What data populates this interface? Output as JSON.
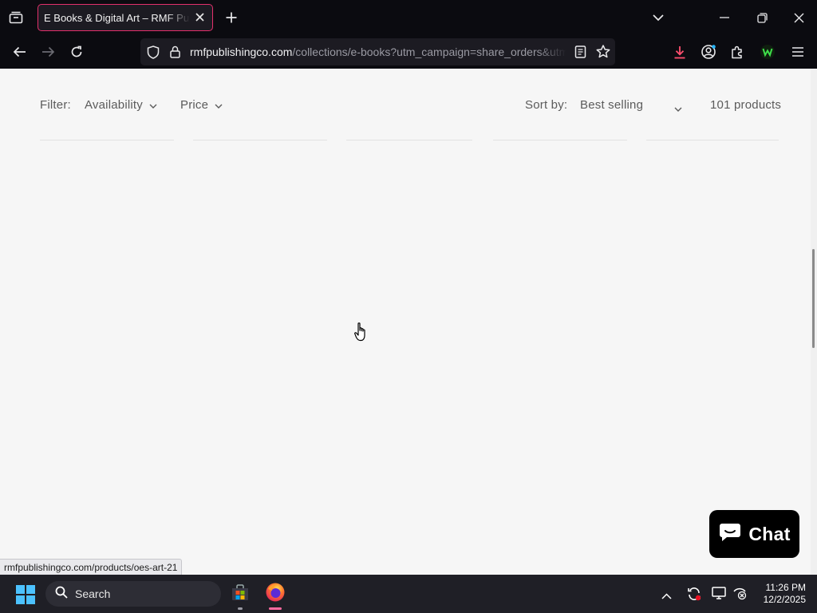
{
  "browser": {
    "tab_title": "E Books & Digital Art – RMF Publishing Co",
    "url_domain": "rmfpublishingco.com",
    "url_path": "/collections/e-books?utm_campaign=share_orders&utm_medium=product_sync&utm_source=shop",
    "accent_color": "#e3306c",
    "icons": [
      "tab-list-icon",
      "close-icon",
      "plus-icon",
      "chevron-down-icon",
      "minimize-icon",
      "restore-icon",
      "back-icon",
      "forward-icon",
      "reload-icon",
      "shield-icon",
      "lock-icon",
      "reader-view-icon",
      "star-icon",
      "download-icon",
      "account-icon",
      "extensions-icon",
      "extension-w-icon",
      "menu-icon"
    ]
  },
  "filters": {
    "filter_label": "Filter:",
    "availability": "Availability",
    "price": "Price",
    "sort_label": "Sort by:",
    "sort_value": "Best selling",
    "product_count": "101 products"
  },
  "chat": {
    "label": "Chat"
  },
  "status_bar": {
    "url": "rmfpublishingco.com/products/oes-art-21"
  },
  "taskbar": {
    "search_label": "Search",
    "time": "11:26 PM",
    "date": "12/2/2025",
    "icons": [
      "windows-start-icon",
      "search-icon",
      "store-icon",
      "firefox-icon",
      "chevron-up-icon",
      "sync-icon",
      "display-icon",
      "network-icon"
    ]
  }
}
